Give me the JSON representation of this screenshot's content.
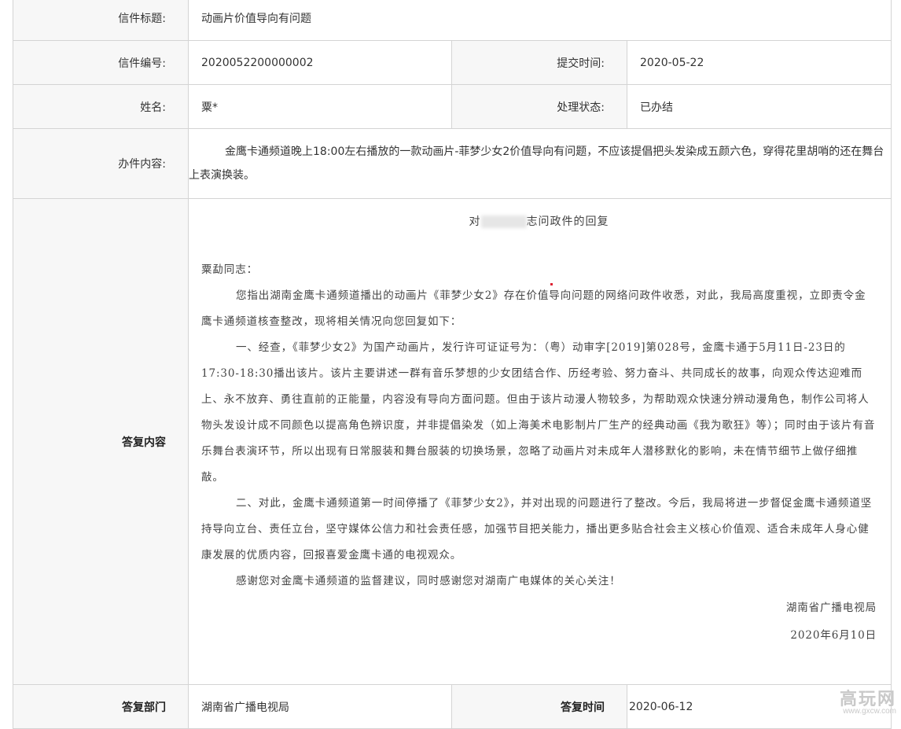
{
  "letter": {
    "title_label": "信件标题:",
    "title_value": "动画片价值导向有问题",
    "number_label": "信件编号:",
    "number_value": "2020052200000002",
    "submit_time_label": "提交时间:",
    "submit_time_value": "2020-05-22",
    "name_label": "姓名:",
    "name_value": "粟*",
    "status_label": "处理状态:",
    "status_value": "已办结",
    "content_label": "办件内容:",
    "content_text": "金鹰卡通频道晚上18:00左右播放的一款动画片-菲梦少女2价值导向有问题，不应该提倡把头发染成五颜六色，穿得花里胡哨的还在舞台上表演换装。"
  },
  "reply": {
    "label": "答复内容",
    "title_prefix": "对",
    "title_suffix": "志问政件的回复",
    "salutation": "粟勐同志：",
    "paragraphs": [
      "您指出湖南金鹰卡通频道播出的动画片《菲梦少女2》存在价值导向问题的网络问政件收悉，对此，我局高度重视，立即责令金鹰卡通频道核查整改，现将相关情况向您回复如下：",
      "一、经查，《菲梦少女2》为国产动画片，发行许可证证号为：（粤）动审字[2019]第028号，金鹰卡通于5月11日-23日的17:30-18:30播出该片。该片主要讲述一群有音乐梦想的少女团结合作、历经考验、努力奋斗、共同成长的故事，向观众传达迎难而上、永不放弃、勇往直前的正能量，内容没有导向方面问题。但由于该片动漫人物较多，为帮助观众快速分辨动漫角色，制作公司将人物头发设计成不同颜色以提高角色辨识度，并非提倡染发（如上海美术电影制片厂生产的经典动画《我为歌狂》等）；同时由于该片有音乐舞台表演环节，所以出现有日常服装和舞台服装的切换场景，忽略了动画片对未成年人潜移默化的影响，未在情节细节上做仔细推敲。",
      "二、对此，金鹰卡通频道第一时间停播了《菲梦少女2》，并对出现的问题进行了整改。今后，我局将进一步督促金鹰卡通频道坚持导向立台、责任立台，坚守媒体公信力和社会责任感，加强节目把关能力，播出更多贴合社会主义核心价值观、适合未成年人身心健康发展的优质内容，回报喜爱金鹰卡通的电视观众。",
      "感谢您对金鹰卡通频道的监督建议，同时感谢您对湖南广电媒体的关心关注！"
    ],
    "signature_org": "湖南省广播电视局",
    "signature_date": "2020年6月10日"
  },
  "footer": {
    "dept_label": "答复部门",
    "dept_value": "湖南省广播电视局",
    "time_label": "答复时间",
    "time_value": "2020-06-12"
  },
  "watermark": {
    "text": "高玩网",
    "url": "www.gxcw.com"
  }
}
